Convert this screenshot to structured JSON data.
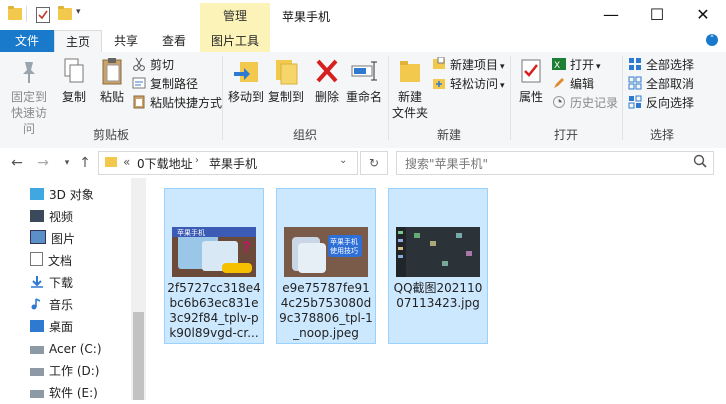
{
  "titlebar": {
    "context_tab": "管理",
    "title": "苹果手机",
    "minimize": "—",
    "maximize": "☐",
    "close": "✕"
  },
  "tabs": {
    "file": "文件",
    "home": "主页",
    "share": "共享",
    "view": "查看",
    "picture_tools": "图片工具"
  },
  "ribbon": {
    "clipboard": {
      "group": "剪贴板",
      "pin": "固定到",
      "pin2": "快速访问",
      "copy": "复制",
      "paste": "粘贴",
      "cut": "剪切",
      "copy_path": "复制路径",
      "paste_shortcut": "粘贴快捷方式"
    },
    "organize": {
      "group": "组织",
      "move_to": "移动到",
      "copy_to": "复制到",
      "delete": "删除",
      "rename": "重命名"
    },
    "new": {
      "group": "新建",
      "new_folder": "新建",
      "new_folder2": "文件夹",
      "new_item": "新建项目",
      "easy_access": "轻松访问"
    },
    "open": {
      "group": "打开",
      "properties": "属性",
      "open": "打开",
      "edit": "编辑",
      "history": "历史记录"
    },
    "select": {
      "group": "选择",
      "select_all": "全部选择",
      "select_none": "全部取消",
      "invert": "反向选择"
    }
  },
  "address": {
    "prefix": "«",
    "crumb1": "0下载地址",
    "crumb2": "苹果手机",
    "search_placeholder": "搜索\"苹果手机\""
  },
  "navpane": {
    "items": [
      "3D 对象",
      "视频",
      "图片",
      "文档",
      "下载",
      "音乐",
      "桌面",
      "Acer (C:)",
      "工作 (D:)",
      "软件 (E:)"
    ]
  },
  "files": [
    {
      "name": "2f5727cc318e4bc6b63ec831e3c92f84_tplv-pk90l89vgd-cr...",
      "thumb_text": "苹果手机"
    },
    {
      "name": "e9e75787fe914c25b753080d9c378806_tpl-1_noop.jpeg",
      "thumb_text": "苹果手机使用技巧"
    },
    {
      "name": "QQ截图20211007113423.jpg",
      "thumb_text": ""
    }
  ],
  "colors": {
    "accent": "#1979ca",
    "context_tab": "#fcf3b8",
    "selection": "#cce8ff",
    "selection_border": "#99d1ff"
  }
}
